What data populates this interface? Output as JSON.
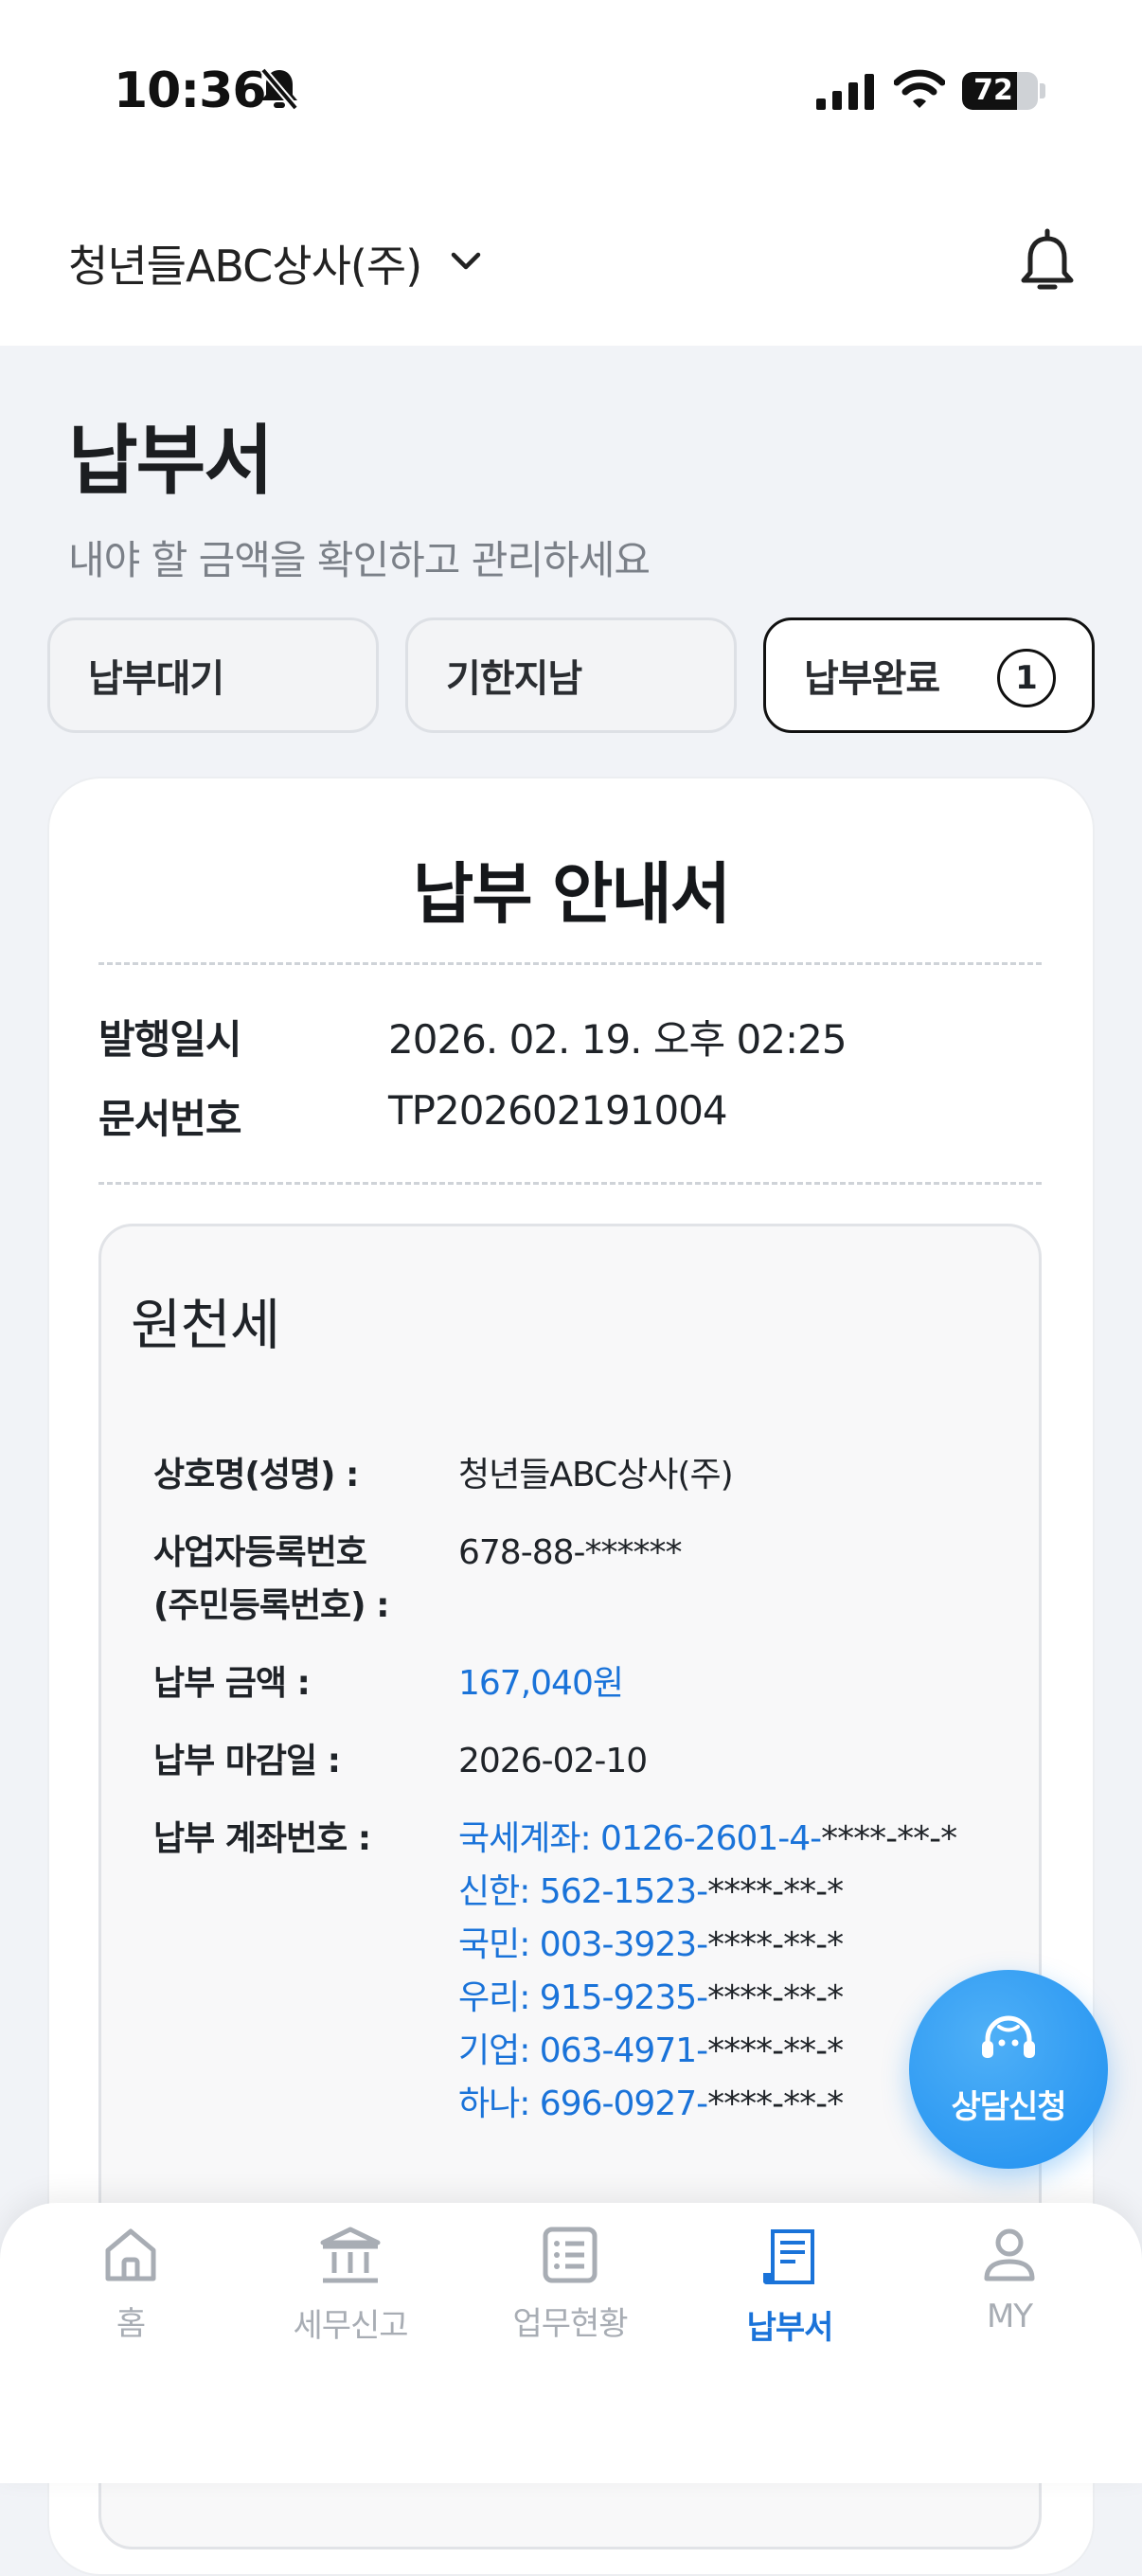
{
  "status_bar": {
    "time": "10:36",
    "battery": "72",
    "battery_level": 0.72
  },
  "header": {
    "company": "청년들ABC상사(주)"
  },
  "page": {
    "title": "납부서",
    "subtitle": "내야 할 금액을 확인하고 관리하세요"
  },
  "tabs": [
    {
      "label": "납부대기"
    },
    {
      "label": "기한지남"
    },
    {
      "label": "납부완료",
      "count": "1",
      "active": true
    }
  ],
  "notice": {
    "title": "납부 안내서",
    "issued_label": "발행일시",
    "issued_value": "2026. 02. 19. 오후 02:25",
    "docno_label": "문서번호",
    "docno_value": "TP202602191004"
  },
  "tax": {
    "title": "원천세",
    "name_label": "상호명(성명) :",
    "name_value": "청년들ABC상사(주)",
    "biz_label_1": "사업자등록번호",
    "biz_label_2": "(주민등록번호) :",
    "biz_value": "678-88-******",
    "amount_label": "납부 금액 :",
    "amount_value": "167,040원",
    "due_label": "납부 마감일 :",
    "due_value": "2026-02-10",
    "accounts_label": "납부 계좌번호 :",
    "accounts": [
      {
        "prefix": "국세계좌: 0126-2601-4-",
        "masked": "****-**-*"
      },
      {
        "prefix": "신한: 562-1523-",
        "masked": "****-**-*"
      },
      {
        "prefix": "국민: 003-3923-",
        "masked": "****-**-*"
      },
      {
        "prefix": "우리: 915-9235-",
        "masked": "****-**-*"
      },
      {
        "prefix": "기업: 063-4971-",
        "masked": "****-**-*"
      },
      {
        "prefix": "하나: 696-0927-",
        "masked": "****-**-*"
      }
    ]
  },
  "consult": {
    "label": "상담신청"
  },
  "nav": [
    {
      "label": "홈",
      "icon": "home-icon"
    },
    {
      "label": "세무신고",
      "icon": "bank-icon"
    },
    {
      "label": "업무현황",
      "icon": "list-icon"
    },
    {
      "label": "납부서",
      "icon": "receipt-icon",
      "active": true
    },
    {
      "label": "MY",
      "icon": "user-icon"
    }
  ],
  "colors": {
    "accent": "#1a73d9",
    "background": "#f1f3f7"
  }
}
